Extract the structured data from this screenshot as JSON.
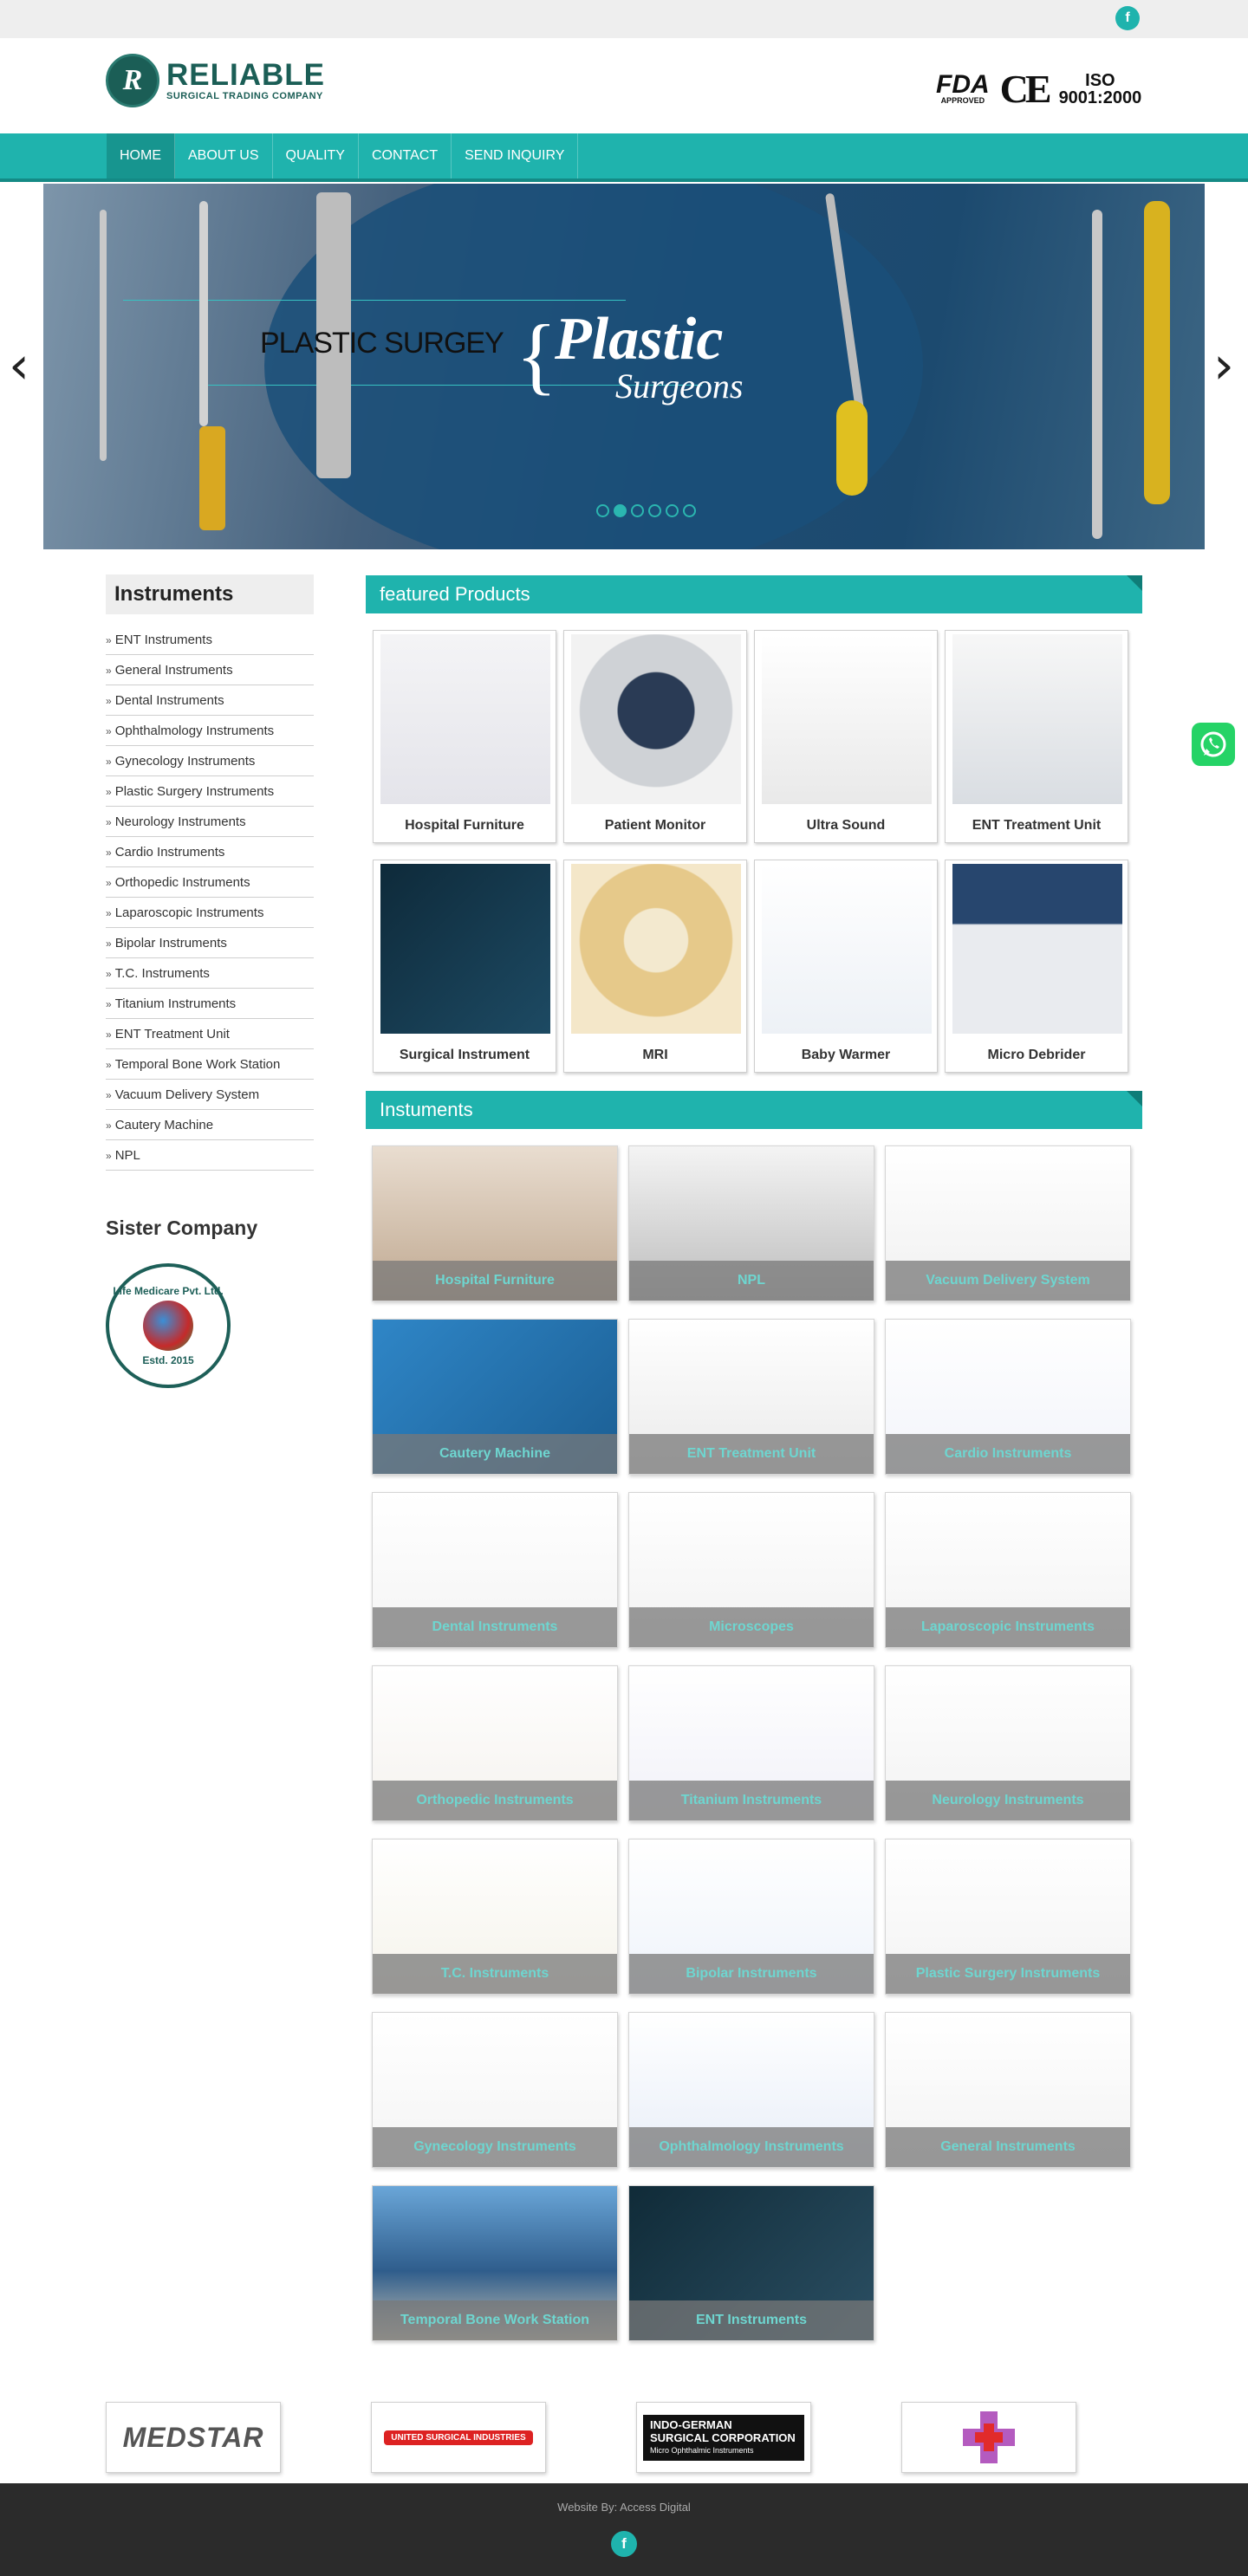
{
  "topbar": {
    "facebook_icon": "f"
  },
  "header": {
    "logo_letter": "R",
    "logo_name": "RELIABLE",
    "logo_tagline": "SURGICAL TRADING COMPANY",
    "cert_fda": "FDA",
    "cert_fda_sub": "APPROVED",
    "cert_ce": "CE",
    "cert_iso": "ISO",
    "cert_iso_num": "9001:2000"
  },
  "nav": {
    "items": [
      {
        "label": "HOME",
        "active": true
      },
      {
        "label": "ABOUT US"
      },
      {
        "label": "QUALITY"
      },
      {
        "label": "CONTACT"
      },
      {
        "label": "SEND INQUIRY"
      }
    ]
  },
  "slider": {
    "caption": "PLASTIC SURGEY",
    "script_title": "Plastic",
    "script_subtitle": "Surgeons",
    "slide_count": 6,
    "active_slide": 2,
    "prev_arrow": "‹",
    "next_arrow": "›"
  },
  "sidebar": {
    "title": "Instruments",
    "items": [
      "ENT Instruments",
      "General Instruments",
      "Dental Instruments",
      "Ophthalmology Instruments",
      "Gynecology Instruments",
      "Plastic Surgery Instruments",
      "Neurology Instruments",
      "Cardio Instruments",
      "Orthopedic Instruments",
      "Laparoscopic Instruments",
      "Bipolar Instruments",
      "T.C. Instruments",
      "Titanium Instruments",
      "ENT Treatment Unit",
      "Temporal Bone Work Station",
      "Vacuum Delivery System",
      "Cautery Machine",
      "NPL"
    ],
    "chevron": "»",
    "sister_title": "Sister Company",
    "sister_logo_top": "Life Medicare Pvt. Ltd.",
    "sister_logo_bottom": "Estd. 2015"
  },
  "featured": {
    "title": "featured Products",
    "products": [
      "Hospital Furniture",
      "Patient Monitor",
      "Ultra Sound",
      "ENT Treatment Unit",
      "Surgical Instrument",
      "MRI",
      "Baby Warmer",
      "Micro Debrider"
    ]
  },
  "instruments": {
    "title": "Instuments",
    "items": [
      "Hospital Furniture",
      "NPL",
      "Vacuum Delivery System",
      "Cautery Machine",
      "ENT Treatment Unit",
      "Cardio Instruments",
      "Dental Instruments",
      "Microscopes",
      "Laparoscopic Instruments",
      "Orthopedic Instruments",
      "Titanium Instruments",
      "Neurology Instruments",
      "T.C. Instruments",
      "Bipolar Instruments",
      "Plastic Surgery Instruments",
      "Gynecology Instruments",
      "Ophthalmology Instruments",
      "General Instruments",
      "Temporal Bone Work Station",
      "ENT Instruments"
    ]
  },
  "brands": {
    "medstar": "MEDSTAR",
    "united": "UNITED SURGICAL INDUSTRIES",
    "indo_line1": "INDO-GERMAN",
    "indo_line2": "SURGICAL CORPORATION",
    "indo_line3": "Micro Ophthalmic Instruments"
  },
  "footer": {
    "credit": "Website By: Access Digital",
    "facebook_icon": "f"
  },
  "colors": {
    "accent": "#1fb3ad",
    "brand_dark": "#1b5e56",
    "footer_bg": "#2b2b2b"
  }
}
